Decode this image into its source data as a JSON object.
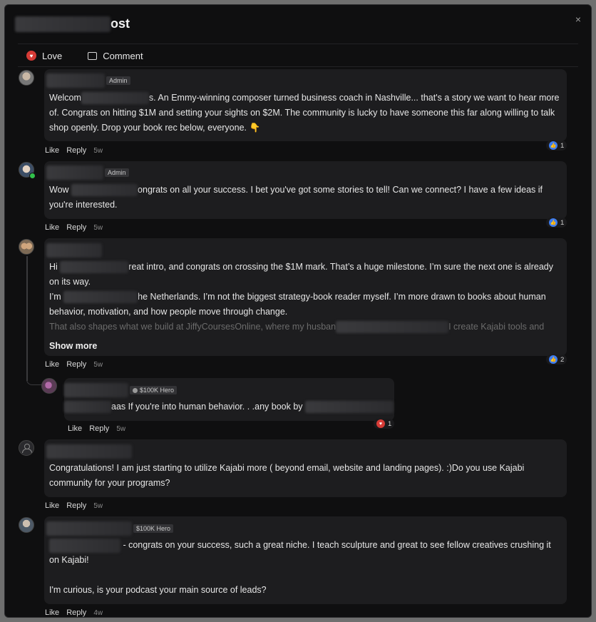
{
  "modal": {
    "title_suffix": "ost",
    "close_icon": "×",
    "actions": {
      "love_label": "Love",
      "comment_label": "Comment"
    }
  },
  "comments": [
    {
      "badge": "Admin",
      "text_a": "Welcom",
      "text_b": "s. An Emmy-winning composer turned business coach in Nashville... that's a story we want to hear more of. Congrats on hitting $1M and setting your sights on $2M. The community is lucky to have someone this far along willing to talk shop openly. Drop your book rec below, everyone. 👇",
      "like": "Like",
      "reply": "Reply",
      "time": "5w",
      "reactions": "1"
    },
    {
      "badge": "Admin",
      "text_a": "Wow",
      "text_b": "ongrats on all your success. I bet you've got some stories to tell! Can we connect? I have a few ideas if you're interested.",
      "like": "Like",
      "reply": "Reply",
      "time": "5w",
      "reactions": "1"
    },
    {
      "p1_a": "Hi",
      "p1_b": "reat intro, and congrats on crossing the $1M mark. That’s a huge milestone. I’m sure the next one is already on its way.",
      "p2_a": "I’m",
      "p2_b": "he Netherlands. I’m not the biggest strategy-book reader myself. I’m more drawn to books about human behavior, motivation, and how people move through change.",
      "p3_a": "That also shapes what we build at JiffyCoursesOnline, where my husban",
      "p3_b": "I create Kajabi tools and",
      "show_more": "Show more",
      "like": "Like",
      "reply": "Reply",
      "time": "5w",
      "reactions": "2"
    },
    {
      "badge": "$100K Hero",
      "text_b": "aas If you're into human behavior. . .any book by",
      "like": "Like",
      "reply": "Reply",
      "time": "5w",
      "reactions": "1"
    },
    {
      "text": "Congratulations! I am just starting to utilize Kajabi more ( beyond email, website and landing pages). :)Do you use Kajabi community for your programs?",
      "like": "Like",
      "reply": "Reply",
      "time": "5w"
    },
    {
      "badge": "$100K Hero",
      "text_b": " - congrats on your success, such a great niche. I teach sculpture and great to see fellow creatives crushing it on Kajabi!",
      "text_c": "I'm curious, is your podcast your main source of leads?",
      "like": "Like",
      "reply": "Reply",
      "time": "4w"
    }
  ],
  "colors": {
    "background": "#0f0f10",
    "card": "#1d1d1f",
    "like_blue": "#3d7cf0",
    "love_red": "#d63b36",
    "online_green": "#31c04b"
  }
}
